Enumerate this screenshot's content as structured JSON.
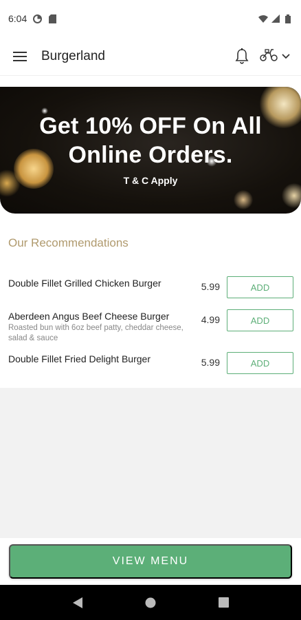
{
  "status_bar": {
    "time": "6:04",
    "icons": [
      "data-saver-icon",
      "sim-card-icon",
      "wifi-icon",
      "signal-icon",
      "battery-icon"
    ]
  },
  "app_bar": {
    "title": "Burgerland",
    "icons": [
      "hamburger-menu-icon",
      "bell-icon",
      "scooter-icon",
      "chevron-down-icon"
    ]
  },
  "banner": {
    "headline": "Get 10% OFF On All\nOnline Orders.",
    "subtext": "T & C Apply"
  },
  "recommendations": {
    "title": "Our Recommendations",
    "items": [
      {
        "name": "Double Fillet Grilled Chicken Burger",
        "description": "",
        "price": "5.99",
        "button": "ADD"
      },
      {
        "name": "Aberdeen Angus Beef Cheese Burger",
        "description": "Roasted bun with 6oz beef patty, cheddar cheese, salad & sauce",
        "price": "4.99",
        "button": "ADD"
      },
      {
        "name": "Double Fillet Fried Delight Burger",
        "description": "",
        "price": "5.99",
        "button": "ADD"
      }
    ]
  },
  "footer": {
    "view_menu_label": "VIEW MENU"
  },
  "nav_bar": {
    "icons": [
      "back-icon",
      "home-icon",
      "recents-icon"
    ]
  },
  "colors": {
    "accent_green": "#5caf78",
    "section_gold": "#b09a6e"
  }
}
